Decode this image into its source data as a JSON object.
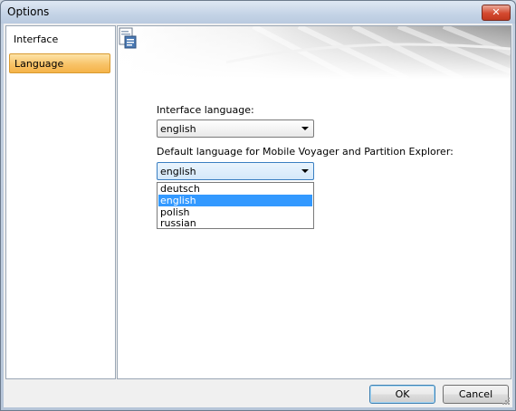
{
  "window": {
    "title": "Options",
    "close_icon": "close-icon",
    "close_glyph": "✕"
  },
  "sidebar": {
    "items": [
      {
        "label": "Interface",
        "selected": false
      },
      {
        "label": "Language",
        "selected": true
      }
    ]
  },
  "header": {
    "icon": "language-settings-icon"
  },
  "form": {
    "interface_language": {
      "label": "Interface language:",
      "value": "english"
    },
    "default_language": {
      "label": "Default language for Mobile Voyager and Partition Explorer:",
      "value": "english",
      "options": [
        "deutsch",
        "english",
        "polish",
        "russian"
      ],
      "highlighted": "english"
    }
  },
  "footer": {
    "ok_label": "OK",
    "cancel_label": "Cancel"
  },
  "colors": {
    "selection_highlight": "#3399ff",
    "nav_selected": "#f8c368",
    "close_button": "#d4492f"
  }
}
